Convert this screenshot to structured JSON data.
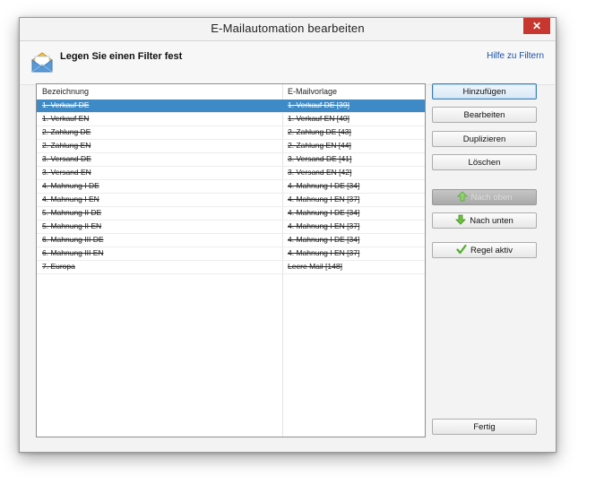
{
  "window": {
    "title": "E-Mailautomation bearbeiten",
    "close_label": "✕"
  },
  "header": {
    "heading": "Legen Sie einen Filter fest",
    "help_link": "Hilfe zu Filtern"
  },
  "table": {
    "columns": [
      "Bezeichnung",
      "E-Mailvorlage"
    ],
    "selected_index": 0,
    "rows": [
      {
        "name": "1. Verkauf DE",
        "template": "1. Verkauf DE [39]"
      },
      {
        "name": "1. Verkauf EN",
        "template": "1. Verkauf EN [40]"
      },
      {
        "name": "2. Zahlung DE",
        "template": "2. Zahlung DE [43]"
      },
      {
        "name": "2. Zahlung EN",
        "template": "2. Zahlung EN [44]"
      },
      {
        "name": "3. Versand DE",
        "template": "3. Versand DE [41]"
      },
      {
        "name": "3. Versand EN",
        "template": "3. Versand EN [42]"
      },
      {
        "name": "4. Mahnung I DE",
        "template": "4. Mahnung I DE [34]"
      },
      {
        "name": "4. Mahnung I EN",
        "template": "4. Mahnung I EN [37]"
      },
      {
        "name": "5. Mahnung II DE",
        "template": "4. Mahnung I DE [34]"
      },
      {
        "name": "5. Mahnung II EN",
        "template": "4. Mahnung I EN [37]"
      },
      {
        "name": "6. Mahnung III DE",
        "template": "4. Mahnung I DE [34]"
      },
      {
        "name": "6. Mahnung III EN",
        "template": "4. Mahnung I EN [37]"
      },
      {
        "name": "7. Europa",
        "template": "Leere Mail [148]"
      }
    ]
  },
  "buttons": {
    "add": "Hinzufügen",
    "edit": "Bearbeiten",
    "duplicate": "Duplizieren",
    "delete": "Löschen",
    "move_up": "Nach oben",
    "move_down": "Nach unten",
    "rule_active": "Regel aktiv",
    "done": "Fertig"
  },
  "colors": {
    "selection": "#3d8ac7",
    "close_button": "#c7372f",
    "link": "#1a4fa8",
    "arrow_green": "#4caf28"
  }
}
